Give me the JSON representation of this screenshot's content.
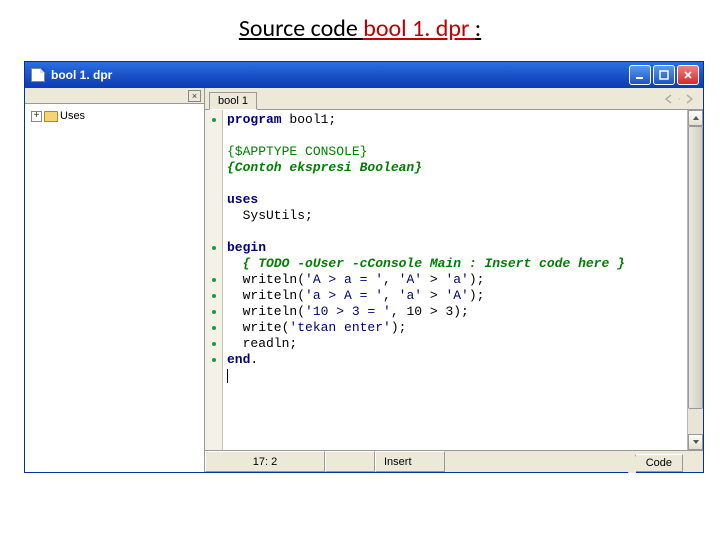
{
  "heading": {
    "prefix": "Source code ",
    "filename": "bool 1. dpr ",
    "suffix": ":"
  },
  "titlebar": {
    "title": "bool 1. dpr"
  },
  "sidebar": {
    "root_label": "Uses"
  },
  "tabs": {
    "active": "bool 1"
  },
  "code": {
    "lines": [
      {
        "mark": "dot",
        "html": "<span class='kw'>program</span> bool1;"
      },
      {
        "mark": "",
        "html": ""
      },
      {
        "mark": "",
        "html": "<span class='dir'>{$APPTYPE CONSOLE}</span>"
      },
      {
        "mark": "",
        "html": "<span class='cm'>{Contoh ekspresi Boolean}</span>"
      },
      {
        "mark": "",
        "html": ""
      },
      {
        "mark": "",
        "html": "<span class='kw'>uses</span>"
      },
      {
        "mark": "",
        "html": "  SysUtils;"
      },
      {
        "mark": "",
        "html": ""
      },
      {
        "mark": "dot",
        "html": "<span class='kw'>begin</span>"
      },
      {
        "mark": "",
        "html": "  <span class='cm'>{ TODO -oUser -cConsole Main : Insert code here }</span>"
      },
      {
        "mark": "dot",
        "html": "  writeln(<span class='str'>'A &gt; a = '</span>, <span class='str'>'A'</span> &gt; <span class='str'>'a'</span>);"
      },
      {
        "mark": "dot",
        "html": "  writeln(<span class='str'>'a &gt; A = '</span>, <span class='str'>'a'</span> &gt; <span class='str'>'A'</span>);"
      },
      {
        "mark": "dot",
        "html": "  writeln(<span class='str'>'10 &gt; 3 = '</span>, 10 &gt; 3);"
      },
      {
        "mark": "dot",
        "html": "  write(<span class='str'>'tekan enter'</span>);"
      },
      {
        "mark": "dot",
        "html": "  readln;"
      },
      {
        "mark": "dot",
        "html": "<span class='kw'>end</span>."
      },
      {
        "mark": "",
        "html": "<span class='caret'></span>"
      }
    ]
  },
  "status": {
    "pos": "17:  2",
    "mode": "Insert",
    "codetab": "Code"
  }
}
